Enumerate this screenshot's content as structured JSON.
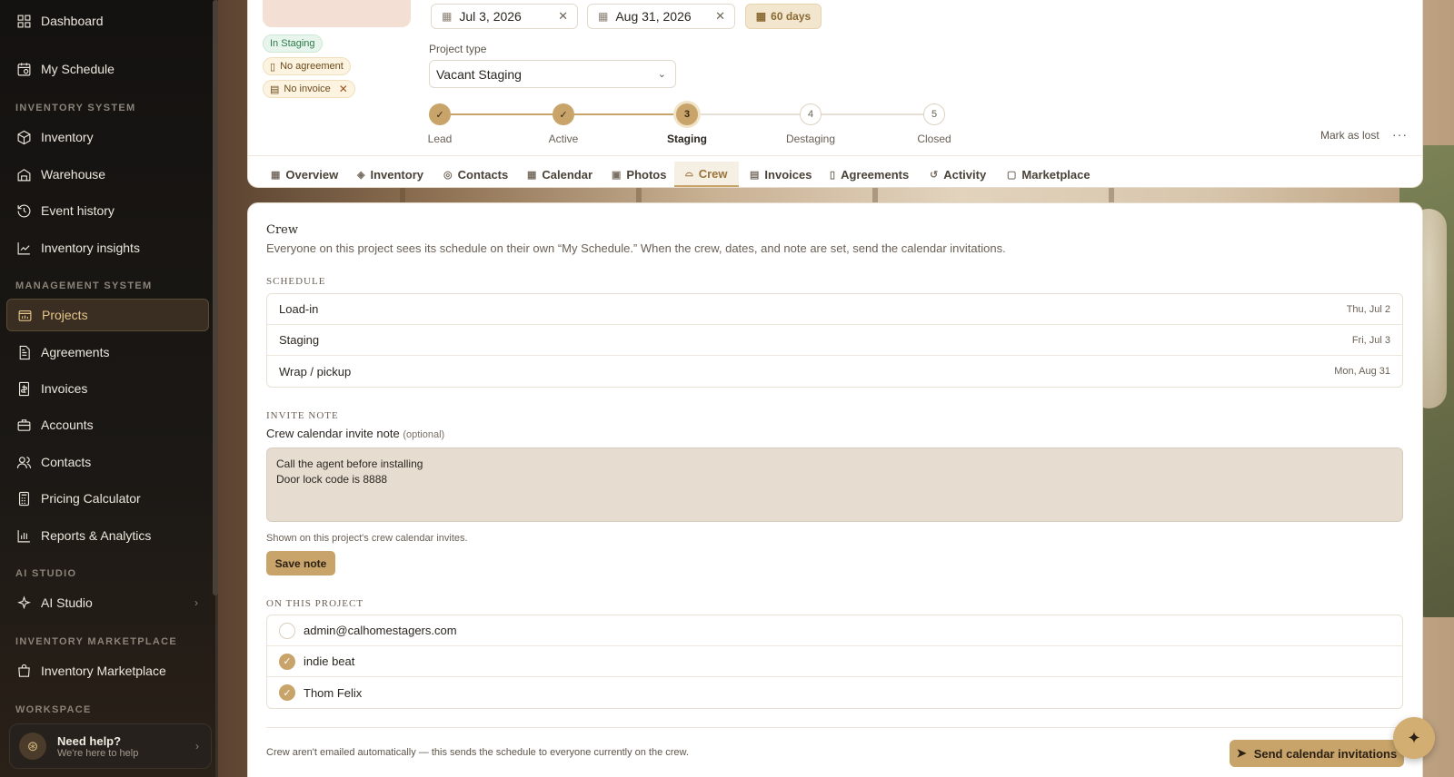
{
  "sidebar": {
    "items_top": [
      {
        "label": "Dashboard",
        "icon": "grid-icon"
      },
      {
        "label": "My Schedule",
        "icon": "calendar-clock-icon"
      }
    ],
    "sections": {
      "inventory_system": "INVENTORY SYSTEM",
      "management_system": "MANAGEMENT SYSTEM",
      "ai_studio": "AI STUDIO",
      "inventory_marketplace": "INVENTORY MARKETPLACE",
      "workspace": "WORKSPACE"
    },
    "inventory_items": [
      {
        "label": "Inventory",
        "icon": "box-icon"
      },
      {
        "label": "Warehouse",
        "icon": "warehouse-icon"
      },
      {
        "label": "Event history",
        "icon": "history-icon"
      },
      {
        "label": "Inventory insights",
        "icon": "chart-line-icon"
      }
    ],
    "management_items": [
      {
        "label": "Projects",
        "icon": "projects-icon"
      },
      {
        "label": "Agreements",
        "icon": "document-icon"
      },
      {
        "label": "Invoices",
        "icon": "invoice-icon"
      },
      {
        "label": "Accounts",
        "icon": "briefcase-icon"
      },
      {
        "label": "Contacts",
        "icon": "users-icon"
      },
      {
        "label": "Pricing Calculator",
        "icon": "calculator-icon"
      },
      {
        "label": "Reports & Analytics",
        "icon": "bar-chart-icon"
      }
    ],
    "ai_items": [
      {
        "label": "AI Studio",
        "icon": "sparkle-icon"
      }
    ],
    "marketplace_items": [
      {
        "label": "Inventory Marketplace",
        "icon": "store-icon"
      }
    ],
    "help": {
      "title": "Need help?",
      "subtitle": "We're here to help"
    }
  },
  "header": {
    "badges": {
      "status": "In Staging",
      "agreement": "No agreement",
      "invoice": "No invoice"
    },
    "start_date": "Jul 3, 2026",
    "end_date": "Aug 31, 2026",
    "duration": "60 days",
    "project_type_label": "Project type",
    "project_type_value": "Vacant Staging",
    "steps": [
      {
        "num": "✓",
        "label": "Lead",
        "state": "done"
      },
      {
        "num": "✓",
        "label": "Active",
        "state": "done"
      },
      {
        "num": "3",
        "label": "Staging",
        "state": "current"
      },
      {
        "num": "4",
        "label": "Destaging",
        "state": "todo"
      },
      {
        "num": "5",
        "label": "Closed",
        "state": "todo"
      }
    ],
    "mark_lost": "Mark as lost",
    "more": "···"
  },
  "tabs": [
    {
      "label": "Overview",
      "icon": "grid-icon"
    },
    {
      "label": "Inventory",
      "icon": "box-icon"
    },
    {
      "label": "Contacts",
      "icon": "users-icon"
    },
    {
      "label": "Calendar",
      "icon": "calendar-icon"
    },
    {
      "label": "Photos",
      "icon": "photos-icon"
    },
    {
      "label": "Crew",
      "icon": "helmet-icon"
    },
    {
      "label": "Invoices",
      "icon": "invoice-icon"
    },
    {
      "label": "Agreements",
      "icon": "document-icon"
    },
    {
      "label": "Activity",
      "icon": "history-icon"
    },
    {
      "label": "Marketplace",
      "icon": "store-icon"
    }
  ],
  "active_tab": "Crew",
  "crew": {
    "title": "Crew",
    "description": "Everyone on this project sees its schedule on their own “My Schedule.” When the crew, dates, and note are set, send the calendar invitations.",
    "schedule_heading": "SCHEDULE",
    "schedule": [
      {
        "label": "Load-in",
        "date": "Thu, Jul 2"
      },
      {
        "label": "Staging",
        "date": "Fri, Jul 3"
      },
      {
        "label": "Wrap / pickup",
        "date": "Mon, Aug 31"
      }
    ],
    "invite_heading": "INVITE NOTE",
    "note_label": "Crew calendar invite note",
    "note_optional": "(optional)",
    "note_value": "Call the agent before installing\nDoor lock code is 8888",
    "note_help": "Shown on this project's crew calendar invites.",
    "save_label": "Save note",
    "members_heading": "ON THIS PROJECT",
    "members": [
      {
        "name": "admin@calhomestagers.com",
        "checked": false
      },
      {
        "name": "indie beat",
        "checked": true
      },
      {
        "name": "Thom Felix",
        "checked": true
      }
    ],
    "footer_note": "Crew aren't emailed automatically — this sends the schedule to everyone currently on the crew.",
    "send_label": "Send calendar invitations"
  },
  "colors": {
    "accent": "#c8a46a",
    "sidebar_bg": "#141210"
  }
}
